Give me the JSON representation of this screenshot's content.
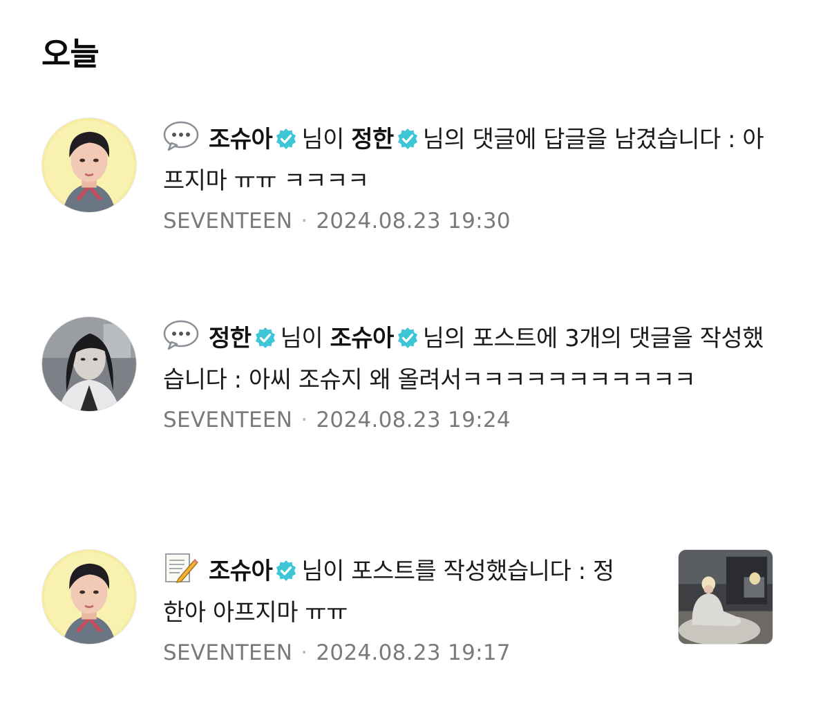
{
  "section": {
    "title": "오늘"
  },
  "badge_color": "#3ec6d6",
  "notifications": [
    {
      "emoji": "speech-balloon-icon",
      "actor": "조슈아",
      "p1": "님이",
      "target": "정한",
      "p2": "님의 댓글에 답글을 남겼습니다 : 아프지마 ㅠㅠ ㅋㅋㅋㅋ",
      "group": "SEVENTEEN",
      "time": "2024.08.23 19:30"
    },
    {
      "emoji": "speech-balloon-icon",
      "actor": "정한",
      "p1": "님이",
      "target": "조슈아",
      "p2": "님의 포스트에 3개의 댓글을 작성했습니다 : 아씨 조슈지 왜 올려서ㅋㅋㅋㅋㅋㅋㅋㅋㅋㅋㅋ",
      "group": "SEVENTEEN",
      "time": "2024.08.23 19:24"
    },
    {
      "emoji": "memo-icon",
      "actor": "조슈아",
      "p1": "님이 포스트를 작성했습니다 : 정한아 아프지마 ㅠㅠ",
      "group": "SEVENTEEN",
      "time": "2024.08.23 19:17"
    }
  ]
}
